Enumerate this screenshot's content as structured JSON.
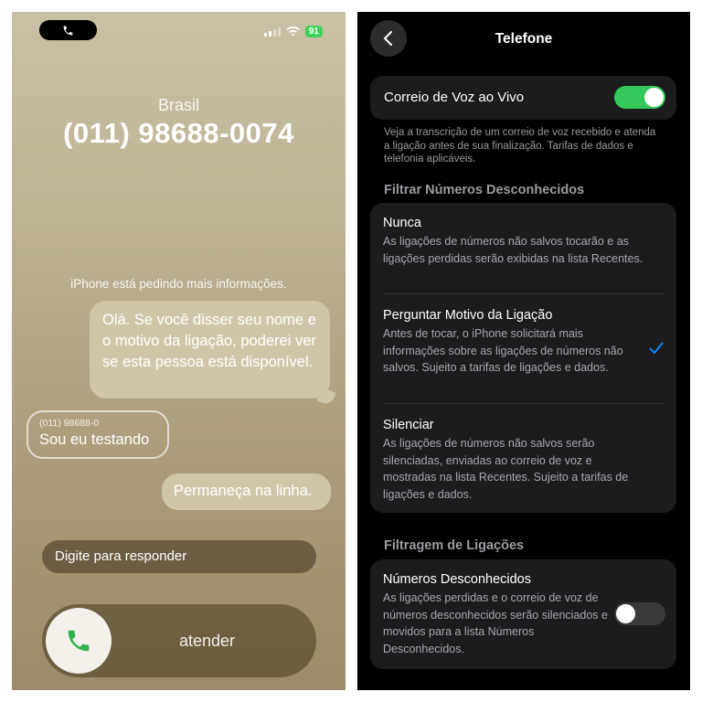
{
  "incoming_call": {
    "country": "Brasil",
    "caller_number": "(011) 98688-0074",
    "info_text": "iPhone está pedindo mais informações.",
    "messages": {
      "iphone_prompt": "Olá. Se você disser seu nome e o motivo da ligação, poderei ver se esta pessoa está disponível.",
      "caller_from": "(011) 98688-0",
      "caller_reply": "Sou eu testando",
      "iphone_hold": "Permaneça na linha."
    },
    "reply_placeholder": "Digite para responder",
    "answer_label": "atender",
    "battery": "91"
  },
  "settings": {
    "title": "Telefone",
    "live_voicemail": {
      "label": "Correio de Voz ao Vivo",
      "enabled": true,
      "footer": "Veja a transcrição de um correio de voz recebido e atenda a ligação antes de sua finalização. Tarifas de dados e telefonia aplicáveis."
    },
    "filter_unknown": {
      "header": "Filtrar Números Desconhecidos",
      "options": [
        {
          "title": "Nunca",
          "description": "As ligações de números não salvos tocarão e as ligações perdidas serão exibidas na lista Recentes.",
          "selected": false
        },
        {
          "title": "Perguntar Motivo da Ligação",
          "description": "Antes de tocar, o iPhone solicitará mais informações sobre as ligações de números não salvos. Sujeito a tarifas de ligações e dados.",
          "selected": true
        },
        {
          "title": "Silenciar",
          "description": "As ligações de números não salvos serão silenciadas, enviadas ao correio de voz e mostradas na lista Recentes. Sujeito a tarifas de ligações e dados.",
          "selected": false
        }
      ]
    },
    "call_filtering": {
      "header": "Filtragem de Ligações",
      "unknown_numbers": {
        "title": "Números Desconhecidos",
        "description": "As ligações perdidas e o correio de voz de números desconhecidos serão silenciados e movidos para a lista Números Desconhecidos.",
        "enabled": false
      }
    }
  },
  "colors": {
    "toggle_on": "#34c759",
    "checkmark": "#0a84ff",
    "call_green": "#2fb34a"
  }
}
